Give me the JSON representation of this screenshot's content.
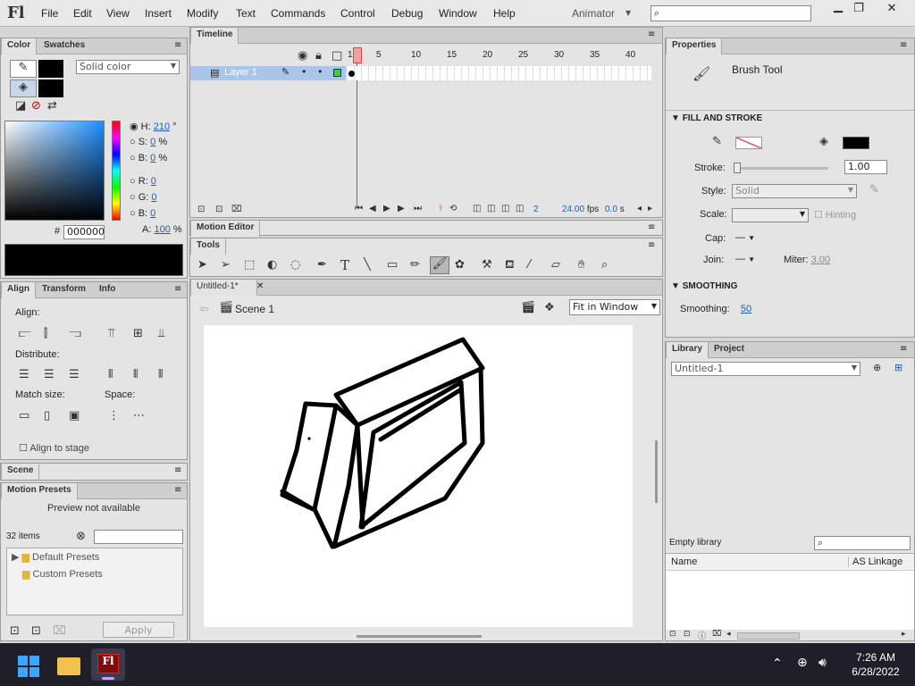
{
  "app": {
    "logo": "Fl",
    "workspace": "Animator",
    "menus": [
      "File",
      "Edit",
      "View",
      "Insert",
      "Modify",
      "Text",
      "Commands",
      "Control",
      "Debug",
      "Window",
      "Help"
    ]
  },
  "color_panel": {
    "tabs": [
      "Color",
      "Swatches"
    ],
    "type": "Solid color",
    "H": "210",
    "S": "0",
    "B": "0",
    "R": "0",
    "G": "0",
    "B2": "0",
    "hex": "000000",
    "A": "100",
    "deg": "°",
    "pct": "%",
    "hash": "#",
    "labels": {
      "H": "H:",
      "S": "S:",
      "B": "B:",
      "R": "R:",
      "G": "G:",
      "Bl": "B:",
      "A": "A:"
    }
  },
  "align_panel": {
    "tabs": [
      "Align",
      "Transform",
      "Info"
    ],
    "align": "Align:",
    "distribute": "Distribute:",
    "match": "Match size:",
    "space": "Space:",
    "stage": "Align to stage"
  },
  "scene_panel": {
    "tab": "Scene"
  },
  "presets": {
    "tab": "Motion Presets",
    "preview": "Preview not available",
    "count": "32 items",
    "folders": [
      "Default Presets",
      "Custom Presets"
    ],
    "apply": "Apply"
  },
  "timeline": {
    "tab": "Timeline",
    "layer": "Layer 1",
    "ticks": [
      "1",
      "5",
      "10",
      "15",
      "20",
      "25",
      "30",
      "35",
      "40"
    ],
    "frame": "2",
    "fps": "24.00",
    "fps_unit": "fps",
    "time": "0.0",
    "time_unit": "s"
  },
  "motion_editor": {
    "tab": "Motion Editor"
  },
  "tools": {
    "tab": "Tools"
  },
  "document": {
    "tab": "Untitled-1*",
    "scene": "Scene 1",
    "zoom": "Fit in Window"
  },
  "properties": {
    "tab": "Properties",
    "tool": "Brush Tool",
    "fill_stroke": "FILL AND STROKE",
    "stroke_label": "Stroke:",
    "stroke_val": "1.00",
    "style_label": "Style:",
    "style_val": "Solid",
    "scale_label": "Scale:",
    "hinting": "Hinting",
    "cap_label": "Cap:",
    "join_label": "Join:",
    "miter_label": "Miter:",
    "miter_val": "3.00",
    "smoothing_sect": "SMOOTHING",
    "smoothing_label": "Smoothing:",
    "smoothing_val": "50",
    "stroke_color": "#000000",
    "fill_color": "#000000"
  },
  "library": {
    "tabs": [
      "Library",
      "Project"
    ],
    "doc": "Untitled-1",
    "empty": "Empty library",
    "col_name": "Name",
    "col_link": "AS Linkage"
  },
  "taskbar": {
    "time": "7:26 AM",
    "date": "6/28/2022",
    "app_label": "Fl"
  }
}
